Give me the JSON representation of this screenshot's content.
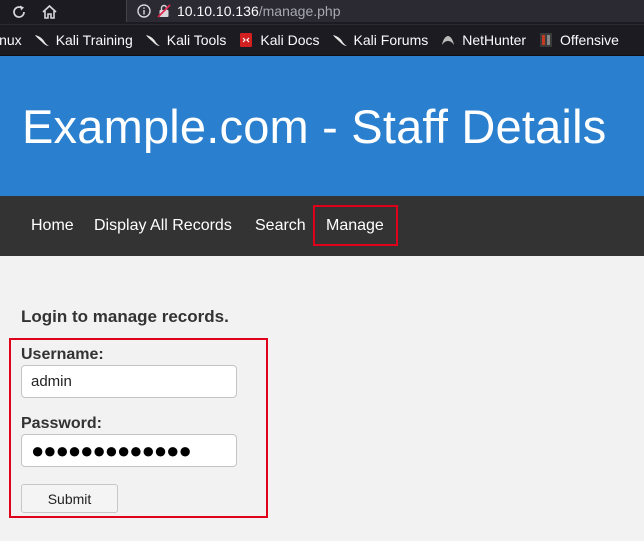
{
  "browser": {
    "url_host": "10.10.10.136",
    "url_path": "/manage.php",
    "bookmarks": [
      {
        "label": "inux",
        "icon": "kali-dragon-icon"
      },
      {
        "label": "Kali Training",
        "icon": "kali-dragon-icon"
      },
      {
        "label": "Kali Tools",
        "icon": "kali-dragon-icon"
      },
      {
        "label": "Kali Docs",
        "icon": "kali-docs-icon"
      },
      {
        "label": "Kali Forums",
        "icon": "kali-dragon-icon"
      },
      {
        "label": "NetHunter",
        "icon": "nethunter-icon"
      },
      {
        "label": "Offensive",
        "icon": "offensive-security-icon"
      }
    ]
  },
  "site": {
    "title": "Example.com - Staff Details",
    "nav": [
      "Home",
      "Display All Records",
      "Search",
      "Manage"
    ],
    "active_nav": "Manage"
  },
  "login": {
    "heading": "Login to manage records.",
    "username_label": "Username:",
    "username_value": "admin",
    "password_label": "Password:",
    "password_mask": "●●●●●●●●●●●●●",
    "submit_label": "Submit"
  },
  "colors": {
    "header_bg": "#2a7fce",
    "nav_bg": "#333333",
    "highlight": "#e0001a"
  }
}
